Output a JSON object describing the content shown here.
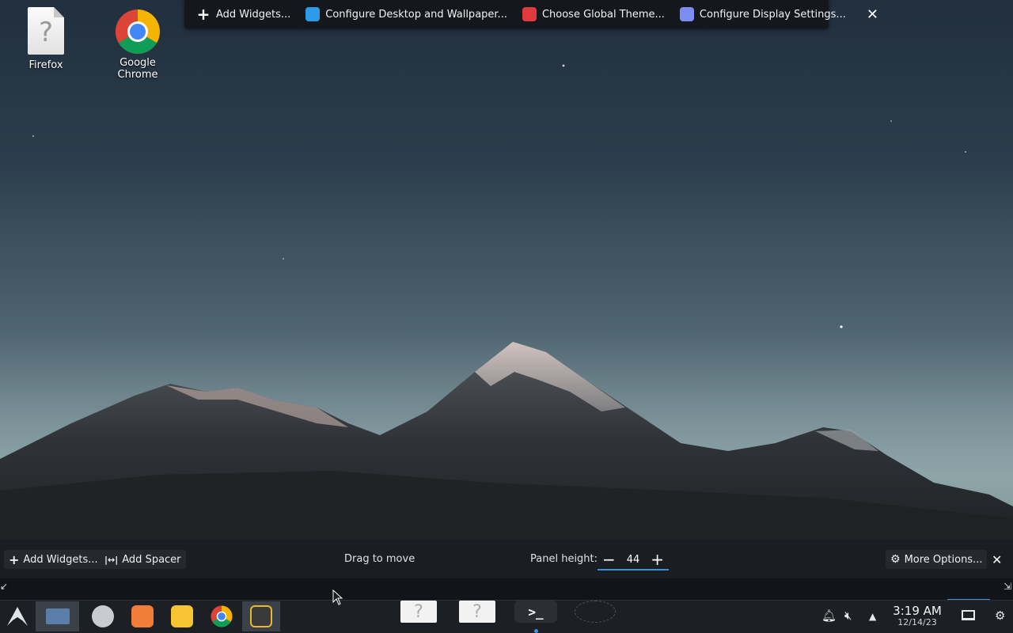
{
  "desktop": {
    "icons": [
      {
        "label": "Firefox",
        "icon": "missing-file-icon"
      },
      {
        "label": "Google Chrome",
        "icon": "chrome-icon"
      }
    ]
  },
  "edit_toolbar": {
    "add_widgets": "Add Widgets...",
    "configure_desktop": "Configure Desktop and Wallpaper...",
    "choose_theme": "Choose Global Theme...",
    "configure_display": "Configure Display Settings...",
    "close": "✕"
  },
  "panel_edit": {
    "add_widgets": "Add Widgets...",
    "add_spacer": "Add Spacer",
    "drag_to_move": "Drag to move",
    "panel_height_label": "Panel height:",
    "panel_height_value": "44",
    "more_options": "More Options...",
    "close": "✕"
  },
  "taskbar": {
    "launcher_icon": "arch-logo-icon",
    "pinned": [
      "show-desktop-icon",
      "settings-app-icon",
      "software-center-icon",
      "file-manager-icon",
      "chrome-icon",
      "terminal-icon"
    ],
    "window_thumbs": [
      "?",
      "?"
    ],
    "terminal_thumb": ">_",
    "clock_time": "3:19 AM",
    "clock_date": "12/14/23"
  },
  "colors": {
    "accent": "#3d8fd8",
    "panel_bg": "#1a1d21",
    "toolbar_bg": "#14181c"
  }
}
